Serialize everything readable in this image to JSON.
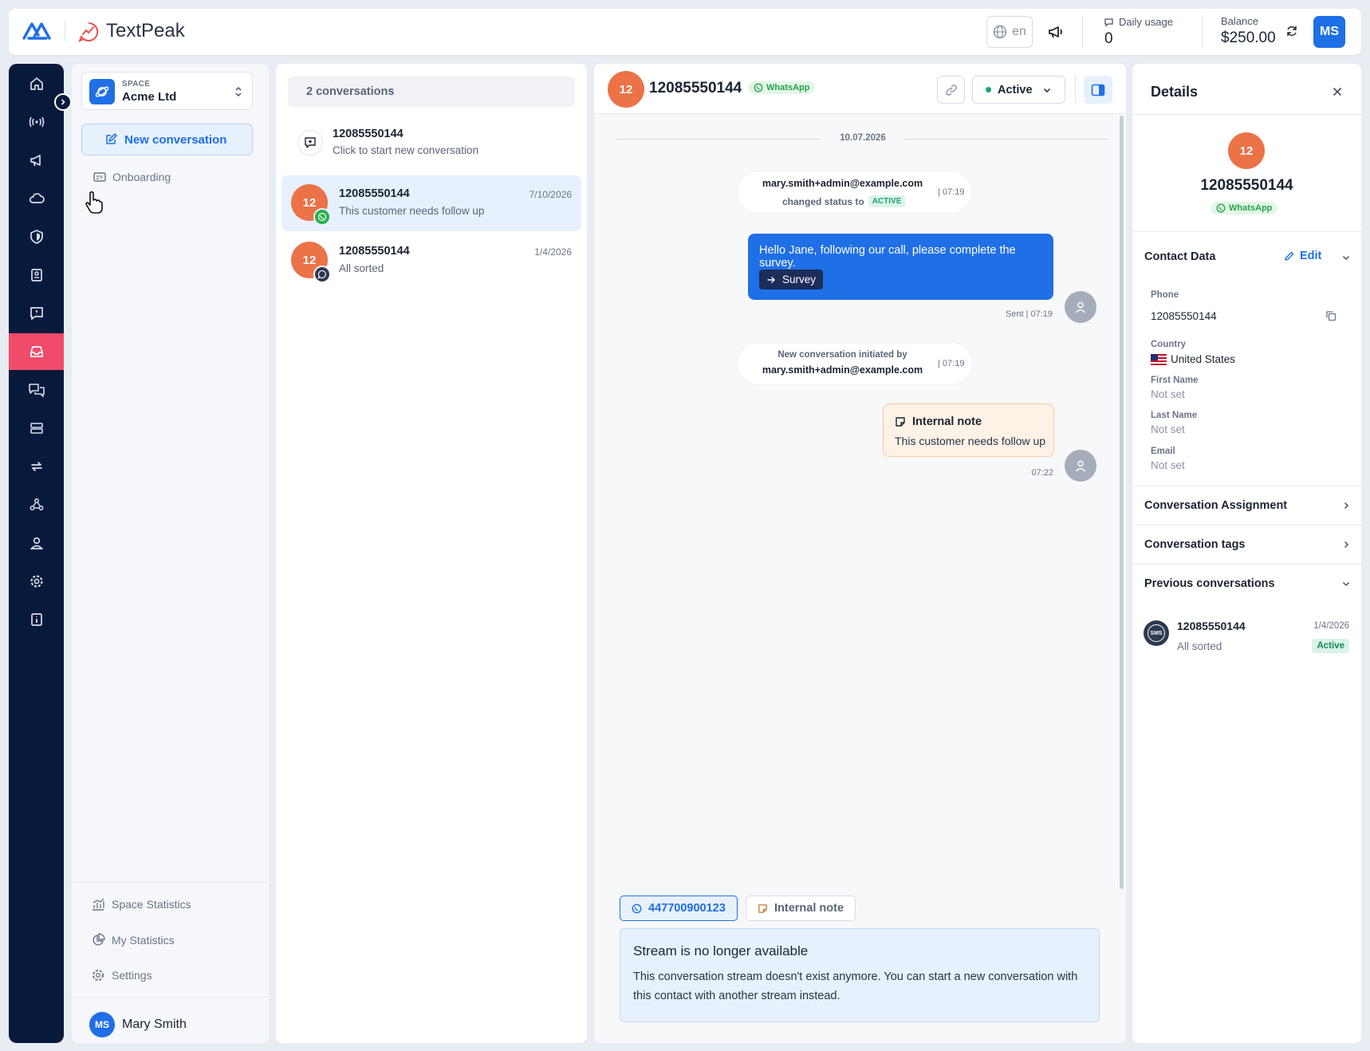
{
  "header": {
    "brand": "TextPeak",
    "lang": "en",
    "daily_usage_label": "Daily usage",
    "daily_usage_value": "0",
    "balance_label": "Balance",
    "balance_value": "$250.00",
    "avatar_initials": "MS"
  },
  "rail_icons": [
    "home-icon",
    "broadcast-icon",
    "megaphone-icon",
    "cloud-icon",
    "shield-icon",
    "contacts-icon",
    "message-report-icon",
    "inbox-icon",
    "chat-bubbles-icon",
    "server-icon",
    "sync-icon",
    "webhook-icon",
    "user-icon",
    "gear-icon",
    "info-icon"
  ],
  "space": {
    "label": "SPACE",
    "name": "Acme Ltd",
    "new_conversation": "New conversation",
    "onboarding": "Onboarding",
    "footer": {
      "space_statistics": "Space Statistics",
      "my_statistics": "My Statistics",
      "settings": "Settings"
    },
    "user": {
      "initials": "MS",
      "name": "Mary Smith"
    }
  },
  "conversations": {
    "count_label": "2 conversations",
    "new_item": {
      "number": "12085550144",
      "hint": "Click to start new conversation"
    },
    "items": [
      {
        "avatar": "12",
        "number": "12085550144",
        "date": "7/10/2026",
        "preview": "This customer needs follow up"
      },
      {
        "avatar": "12",
        "number": "12085550144",
        "date": "1/4/2026",
        "preview": "All sorted"
      }
    ]
  },
  "chat": {
    "avatar": "12",
    "number": "12085550144",
    "channel": "WhatsApp",
    "status": "Active",
    "date_divider": "10.07.2026",
    "event1": {
      "user": "mary.smith+admin@example.com",
      "text": "changed status to",
      "badge": "ACTIVE",
      "time": "| 07:19"
    },
    "message": {
      "text": "Hello Jane, following our call, please complete the survey.",
      "button": "Survey",
      "meta": "Sent | 07:19"
    },
    "event2": {
      "text": "New conversation initiated by",
      "user": "mary.smith+admin@example.com",
      "time": "| 07:19"
    },
    "note": {
      "title": "Internal note",
      "text": "This customer needs follow up",
      "time": "07:22"
    },
    "composer": {
      "stream_tab": "447700900123",
      "note_tab": "Internal note",
      "unavailable_title": "Stream is no longer available",
      "unavailable_text": "This conversation stream doesn't exist anymore. You can start a new conversation with this contact with another stream instead."
    }
  },
  "details": {
    "title": "Details",
    "avatar": "12",
    "number": "12085550144",
    "channel": "WhatsApp",
    "contact_data": "Contact Data",
    "edit": "Edit",
    "phone_label": "Phone",
    "phone_value": "12085550144",
    "country_label": "Country",
    "country_value": "United States",
    "first_name_label": "First Name",
    "first_name_value": "Not set",
    "last_name_label": "Last Name",
    "last_name_value": "Not set",
    "email_label": "Email",
    "email_value": "Not set",
    "assignment": "Conversation Assignment",
    "tags": "Conversation tags",
    "previous": "Previous conversations",
    "prev_item": {
      "badge": "SMS",
      "number": "12085550144",
      "date": "1/4/2026",
      "preview": "All sorted",
      "status": "Active"
    }
  }
}
